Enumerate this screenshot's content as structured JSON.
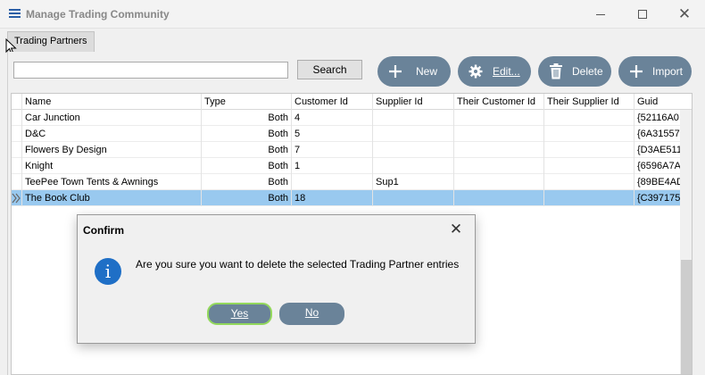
{
  "window": {
    "title": "Manage Trading Community",
    "controls": [
      "minimize-icon",
      "maximize-icon",
      "close-icon"
    ]
  },
  "tabs": [
    {
      "label": "Trading Partners",
      "active": true
    }
  ],
  "search": {
    "value": "",
    "button_label": "Search"
  },
  "toolbar": {
    "new_label": "New",
    "edit_label": "Edit...",
    "delete_label": "Delete",
    "import_label": "Import"
  },
  "grid": {
    "columns": [
      "Name",
      "Type",
      "Customer Id",
      "Supplier Id",
      "Their Customer Id",
      "Their Supplier Id",
      "Guid"
    ],
    "rows": [
      {
        "name": "Car Junction",
        "type": "Both",
        "customer_id": "4",
        "supplier_id": "",
        "their_customer_id": "",
        "their_supplier_id": "",
        "guid": "{52116A0"
      },
      {
        "name": "D&C",
        "type": "Both",
        "customer_id": "5",
        "supplier_id": "",
        "their_customer_id": "",
        "their_supplier_id": "",
        "guid": "{6A31557"
      },
      {
        "name": "Flowers By Design",
        "type": "Both",
        "customer_id": "7",
        "supplier_id": "",
        "their_customer_id": "",
        "their_supplier_id": "",
        "guid": "{D3AE511"
      },
      {
        "name": "Knight",
        "type": "Both",
        "customer_id": "1",
        "supplier_id": "",
        "their_customer_id": "",
        "their_supplier_id": "",
        "guid": "{6596A7A"
      },
      {
        "name": "TeePee Town Tents & Awnings",
        "type": "Both",
        "customer_id": "",
        "supplier_id": "Sup1",
        "their_customer_id": "",
        "their_supplier_id": "",
        "guid": "{89BE4AD"
      },
      {
        "name": "The Book Club",
        "type": "Both",
        "customer_id": "18",
        "supplier_id": "",
        "their_customer_id": "",
        "their_supplier_id": "",
        "guid": "{C397175"
      }
    ]
  },
  "dialog": {
    "title": "Confirm",
    "message": "Are you sure you want to delete the selected Trading Partner entries",
    "yes_label": "Yes",
    "no_label": "No"
  },
  "colors": {
    "accent": "#6a8399",
    "selection": "#99c9ef",
    "info": "#1f6fc6",
    "default_outline": "#93d85c"
  }
}
